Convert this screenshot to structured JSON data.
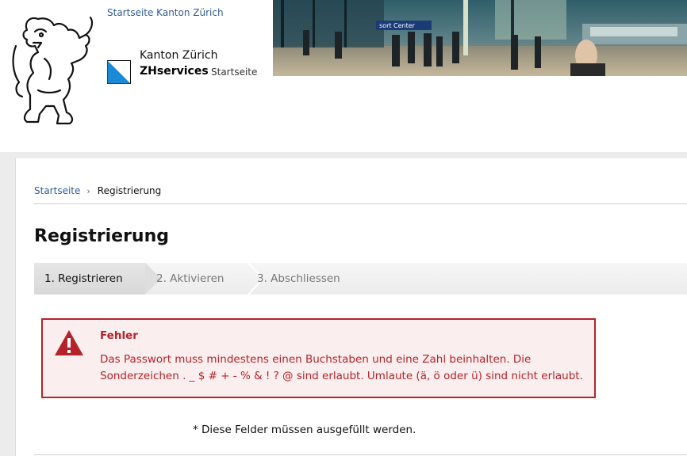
{
  "header": {
    "top_link": "Startseite Kanton Zürich",
    "kanton": "Kanton Zürich",
    "service_name": "ZHservices",
    "service_sub": "Startseite",
    "banner_sign": "sort Center"
  },
  "breadcrumb": {
    "home": "Startseite",
    "separator": "›",
    "current": "Registrierung"
  },
  "page": {
    "title": "Registrierung"
  },
  "steps": [
    {
      "label": "1. Registrieren",
      "active": true
    },
    {
      "label": "2. Aktivieren",
      "active": false
    },
    {
      "label": "3. Abschliessen",
      "active": false
    }
  ],
  "error": {
    "title": "Fehler",
    "message": "Das Passwort muss mindestens einen Buchstaben und eine Zahl beinhalten. Die Sonderzeichen . _ $ # + - % & ! ? @ sind erlaubt. Umlaute (ä, ö oder ü) sind nicht erlaubt.",
    "icon": "warning-triangle-icon",
    "color": "#b4232a"
  },
  "form": {
    "required_note": "* Diese Felder müssen ausgefüllt werden."
  },
  "colors": {
    "link": "#2f5b96",
    "error": "#b4232a",
    "error_bg": "#fbeeee"
  }
}
